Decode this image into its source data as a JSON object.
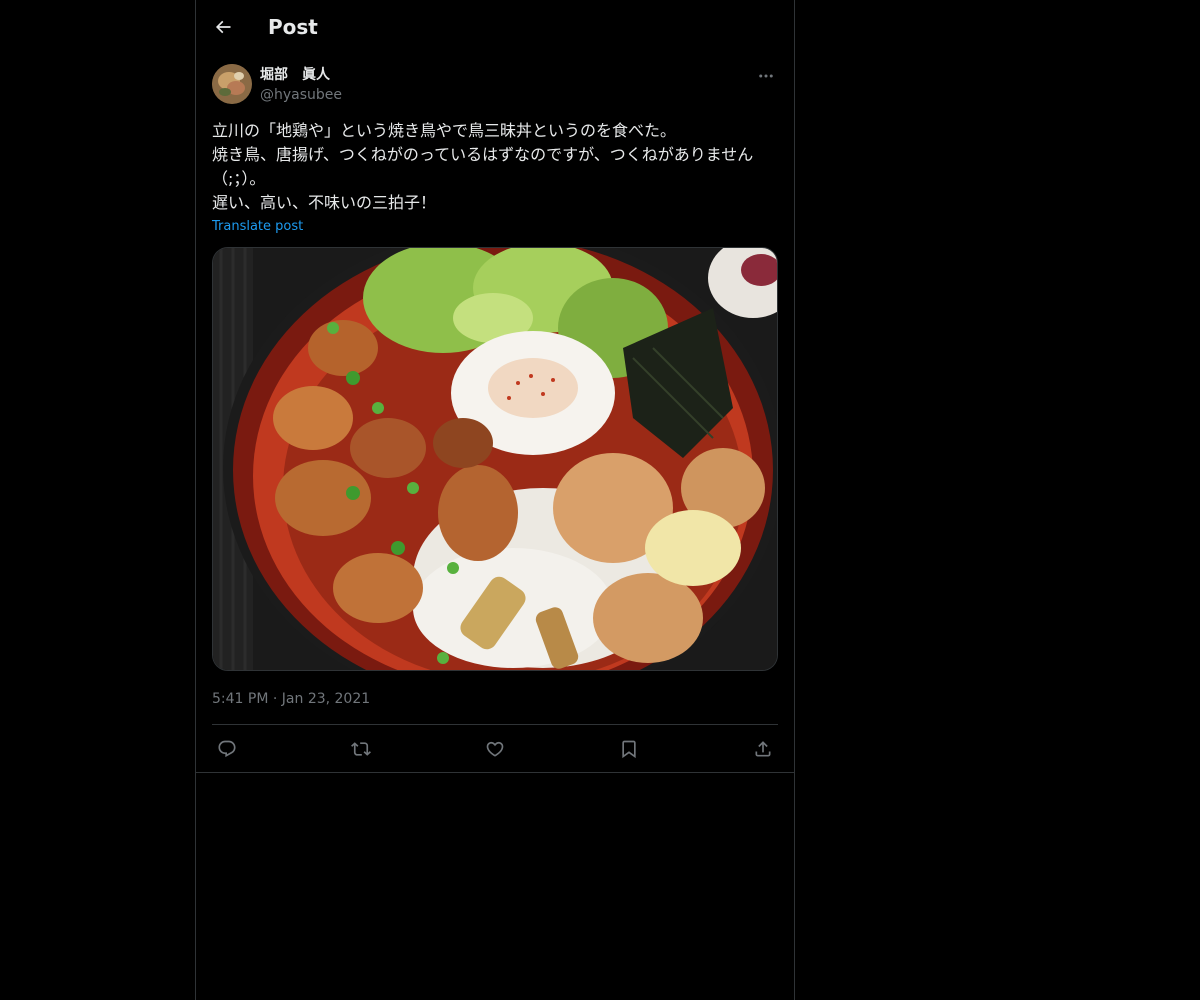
{
  "header": {
    "title": "Post",
    "back_icon": "arrow-left-icon"
  },
  "author": {
    "display_name": "堀部　眞人",
    "handle": "@hyasubee",
    "avatar_icon": "avatar-photo"
  },
  "post": {
    "text_lines": [
      "立川の「地鶏や」という焼き鳥やで鳥三昧丼というのを食べた。",
      "焼き鳥、唐揚げ、つくねがのっているはずなのですが、つくねがありません（;；）。",
      "遅い、高い、不味いの三拍子！"
    ],
    "translate_label": "Translate post",
    "image_icon": "food-photo-rice-bowl",
    "time": "5:41 PM",
    "separator": "·",
    "date": "Jan 23, 2021"
  },
  "actions": {
    "reply_icon": "reply-icon",
    "repost_icon": "repost-icon",
    "like_icon": "heart-icon",
    "bookmark_icon": "bookmark-icon",
    "share_icon": "share-icon"
  },
  "colors": {
    "background": "#000000",
    "text": "#e7e9ea",
    "secondary": "#71767b",
    "link": "#1d9bf0",
    "border": "#2f3336"
  }
}
